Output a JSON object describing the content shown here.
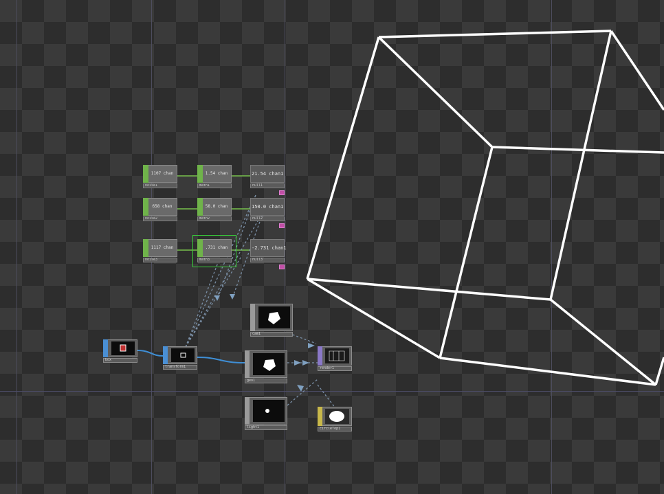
{
  "network": {
    "chops": [
      {
        "name": "noise1",
        "value": "1107 chan",
        "row": 0,
        "col": 0
      },
      {
        "name": "math1",
        "value": "1.54 chan",
        "row": 0,
        "col": 1
      },
      {
        "name": "noise2",
        "value": "658 chan",
        "row": 1,
        "col": 0
      },
      {
        "name": "math2",
        "value": "58.0 chan",
        "row": 1,
        "col": 1
      },
      {
        "name": "noise3",
        "value": "1117 chan",
        "row": 2,
        "col": 0
      },
      {
        "name": "math3",
        "value": ".731 chan",
        "row": 2,
        "col": 1
      }
    ],
    "nulls": [
      {
        "name": "null1",
        "value": "21.54 chan1"
      },
      {
        "name": "null2",
        "value": "150.0 chan1"
      },
      {
        "name": "null3",
        "value": "-2.731 chan1"
      }
    ],
    "tops": {
      "box": "box",
      "transform": "transform1",
      "cam": "cam1",
      "geo": "geo1",
      "light": "light1",
      "render": "render1",
      "circle": "circleTop1"
    }
  },
  "colors": {
    "chop": "#6fb34a",
    "sop": "#4a8fd4",
    "comp": "#d0d0d0",
    "render": "#8a78c8",
    "circle": "#c8b84a",
    "selected": "#39d43a",
    "flag": "#c24fa6",
    "wire_chop": "#78c24c",
    "wire_sop": "#3f8fd6",
    "wire_dep": "#7a8fa6"
  }
}
